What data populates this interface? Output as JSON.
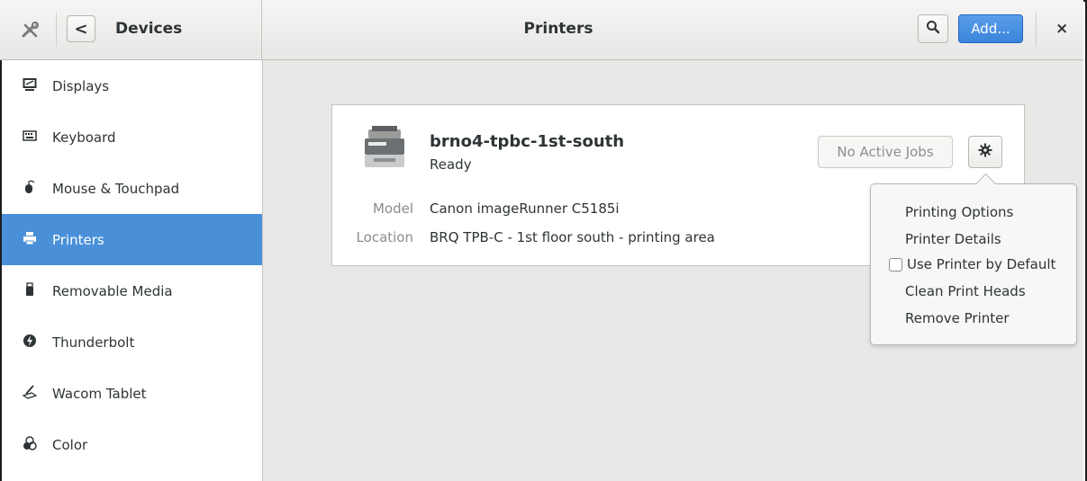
{
  "header": {
    "tools_icon": "tools-icon",
    "back_icon": "chevron-left-icon",
    "back_glyph": "<",
    "section_title": "Devices",
    "page_title": "Printers",
    "search_icon": "search-icon",
    "add_label": "Add...",
    "close_glyph": "×",
    "accent_color": "#4a90d9"
  },
  "sidebar": {
    "items": [
      {
        "label": "Displays",
        "icon": "display-icon"
      },
      {
        "label": "Keyboard",
        "icon": "keyboard-icon"
      },
      {
        "label": "Mouse & Touchpad",
        "icon": "mouse-icon"
      },
      {
        "label": "Printers",
        "icon": "printer-icon",
        "selected": true
      },
      {
        "label": "Removable Media",
        "icon": "usb-icon"
      },
      {
        "label": "Thunderbolt",
        "icon": "thunderbolt-icon"
      },
      {
        "label": "Wacom Tablet",
        "icon": "tablet-icon"
      },
      {
        "label": "Color",
        "icon": "color-icon"
      }
    ]
  },
  "printer": {
    "name": "brno4-tpbc-1st-south",
    "status": "Ready",
    "jobs_label": "No Active Jobs",
    "model_label": "Model",
    "model_value": "Canon imageRunner C5185i",
    "location_label": "Location",
    "location_value": "BRQ TPB-C - 1st floor south - printing area"
  },
  "menu": {
    "printing_options": "Printing Options",
    "printer_details": "Printer Details",
    "use_default": "Use Printer by Default",
    "use_default_checked": false,
    "clean_heads": "Clean Print Heads",
    "remove": "Remove Printer"
  }
}
